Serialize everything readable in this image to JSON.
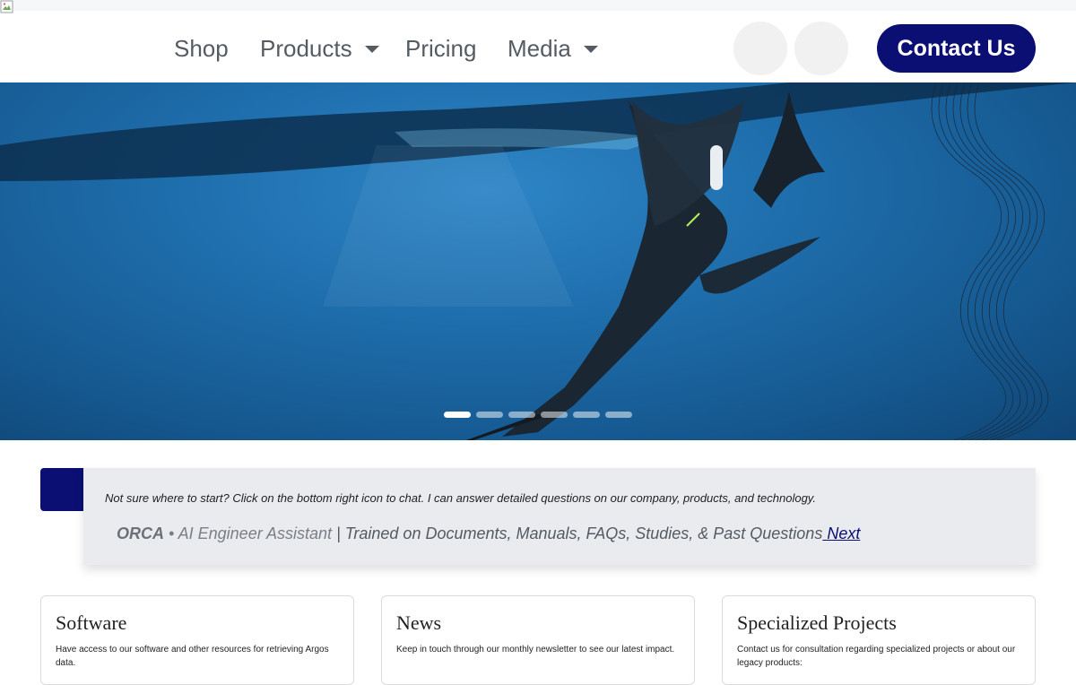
{
  "nav": {
    "items": [
      {
        "label": "Shop"
      },
      {
        "label": "Products"
      },
      {
        "label": "Pricing"
      },
      {
        "label": "Media"
      }
    ],
    "contact_label": "Contact Us"
  },
  "hero": {
    "slide_count": 6,
    "active_slide": 1
  },
  "chat": {
    "hint": "Not sure where to start? Click on the bottom right icon to chat. I can answer detailed questions on our company, products, and technology.",
    "name": "ORCA",
    "subtitle": " • AI Engineer Assistant",
    "description": " | Trained on Documents, Manuals, FAQs, Studies, & Past Questions",
    "next_label": " Next"
  },
  "cards": [
    {
      "title": "Software",
      "text": "Have access to our software and other resources for retrieving Argos data."
    },
    {
      "title": "News",
      "text": "Keep in touch through our monthly newsletter to see our latest impact."
    },
    {
      "title": "Specialized Projects",
      "text": "Contact us for consultation regarding specialized projects or about our legacy products:"
    }
  ],
  "colors": {
    "brand": "#0b0f73",
    "nav_text": "#555b63",
    "panel_bg": "#e9ebee"
  }
}
